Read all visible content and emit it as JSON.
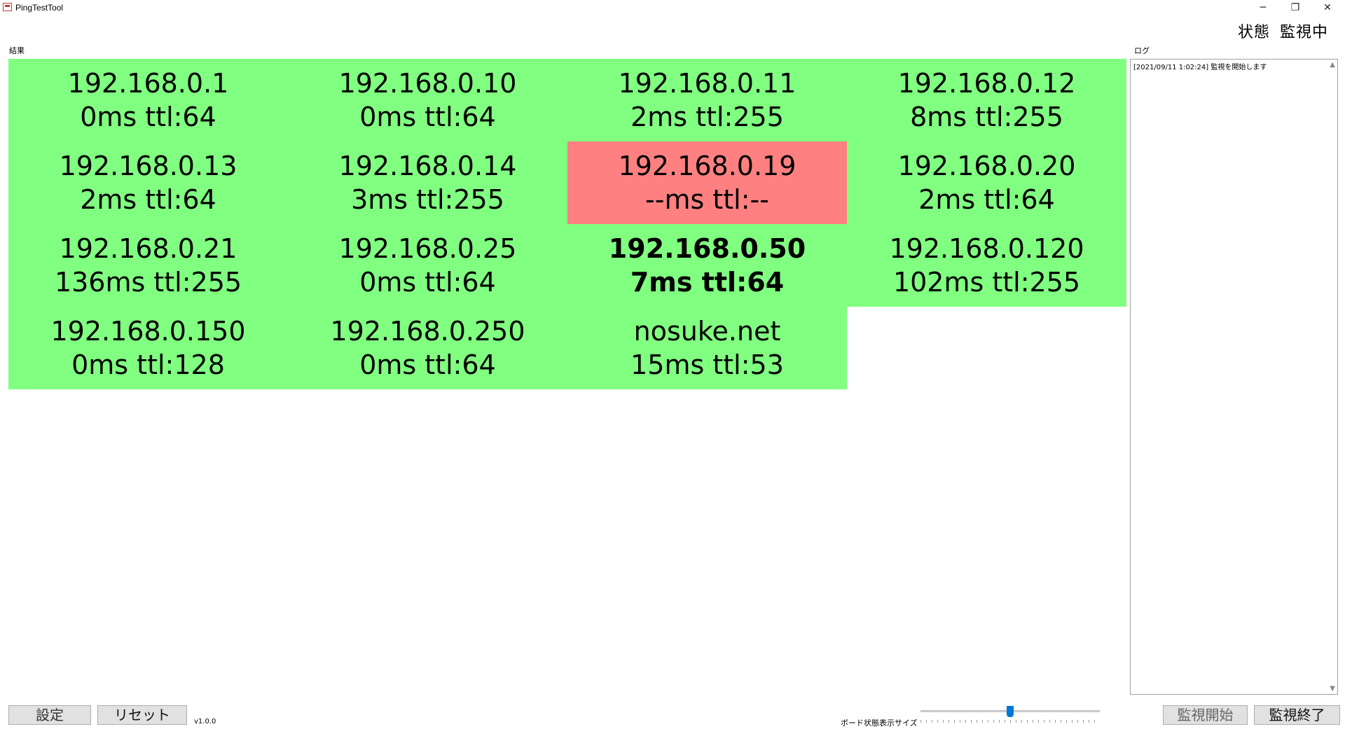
{
  "window": {
    "title": "PingTestTool",
    "minimize": "─",
    "maximize": "❐",
    "close": "✕"
  },
  "status": {
    "label": "状態",
    "value": "監視中"
  },
  "results": {
    "label": "結果",
    "tiles": [
      {
        "host": "192.168.0.1",
        "stats": "0ms ttl:64"
      },
      {
        "host": "192.168.0.10",
        "stats": "0ms ttl:64"
      },
      {
        "host": "192.168.0.11",
        "stats": "2ms ttl:255"
      },
      {
        "host": "192.168.0.12",
        "stats": "8ms ttl:255"
      },
      {
        "host": "192.168.0.13",
        "stats": "2ms ttl:64"
      },
      {
        "host": "192.168.0.14",
        "stats": "3ms ttl:255"
      },
      {
        "host": "192.168.0.19",
        "stats": "--ms ttl:--"
      },
      {
        "host": "192.168.0.20",
        "stats": "2ms ttl:64"
      },
      {
        "host": "192.168.0.21",
        "stats": "136ms ttl:255"
      },
      {
        "host": "192.168.0.25",
        "stats": "0ms ttl:64"
      },
      {
        "host": "192.168.0.50",
        "stats": "7ms ttl:64"
      },
      {
        "host": "192.168.0.120",
        "stats": "102ms ttl:255"
      },
      {
        "host": "192.168.0.150",
        "stats": "0ms ttl:128"
      },
      {
        "host": "192.168.0.250",
        "stats": "0ms ttl:64"
      },
      {
        "host": "nosuke.net",
        "stats": "15ms ttl:53"
      }
    ],
    "colors": {
      "ok": "#80ff80",
      "ng": "#ff8080"
    }
  },
  "log": {
    "label": "ログ",
    "text": "[2021/09/11 1:02:24] 監視を開始します"
  },
  "footer": {
    "settings_label": "設定",
    "reset_label": "リセット",
    "version": "v1.0.0",
    "slider_label": "ボード状態表示サイズ",
    "slider_value": 0.5,
    "start_label": "監視開始",
    "stop_label": "監視終了"
  }
}
